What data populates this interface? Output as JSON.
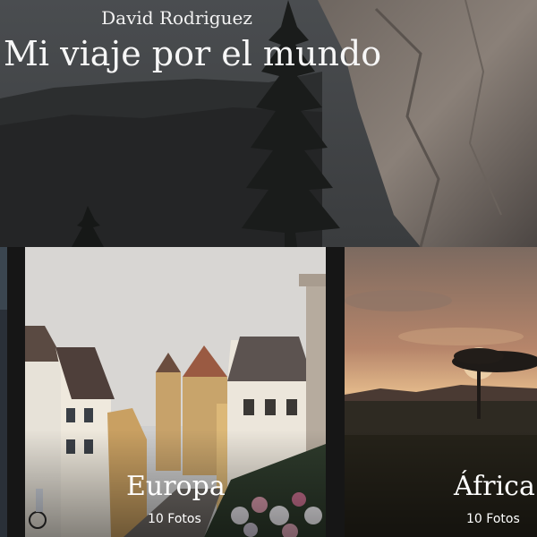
{
  "header": {
    "author": "David Rodriguez",
    "title": "Mi viaje por el mundo"
  },
  "albums": [
    {
      "name": "Europa",
      "count": "10 Fotos"
    },
    {
      "name": "África",
      "count": "10 Fotos"
    }
  ]
}
